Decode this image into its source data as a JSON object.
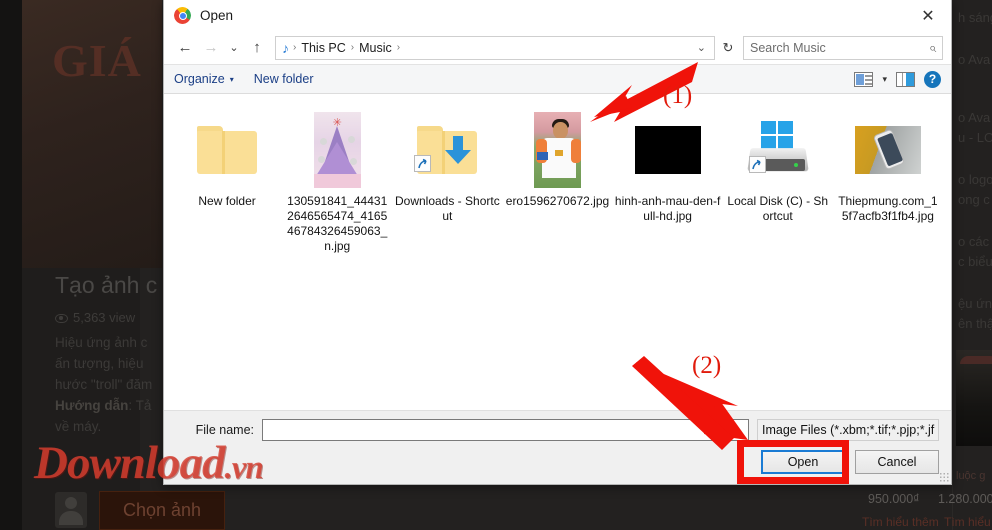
{
  "background": {
    "hero_text": "GIÁ",
    "article_title": "Tạo ảnh c",
    "views": "5,363 view",
    "paragraph_line1": "Hiệu ứng ảnh c",
    "paragraph_line2": "ấn tượng, hiệu",
    "paragraph_line3": "hước \"troll\" đăm",
    "guide_label": "Hướng dẫn",
    "guide_rest": ": Tả",
    "paragraph_line5": "về máy.",
    "choose_image_button": "Chọn ảnh",
    "right_column_lines": [
      "h sáng",
      "o Ava",
      "o Ava",
      "u - LO",
      "o logo",
      "ong c",
      "o các",
      "c biểu",
      "ệu ứng",
      "ên thậ"
    ],
    "price_left": "950.000₫",
    "price_right": "1.280.000",
    "link_left": "Tìm hiểu thêm",
    "link_right": "Tìm hiểu t",
    "product_caption": "luộc g"
  },
  "watermark": {
    "name": "Download",
    "tld": ".vn"
  },
  "dialog": {
    "title": "Open",
    "app_icon": "chrome-icon",
    "close_label": "✕",
    "nav": {
      "back": "←",
      "forward": "→",
      "recent": "⌄",
      "up": "↑",
      "refresh": "↻"
    },
    "breadcrumb": {
      "icon": "♪",
      "items": [
        "This PC",
        "Music"
      ],
      "separator": "›",
      "dropdown": "⌄"
    },
    "search": {
      "placeholder": "Search Music",
      "icon": "⌕"
    },
    "toolbar": {
      "organize": "Organize",
      "organize_caret": "▾",
      "new_folder": "New folder",
      "view_icon": "view-options-icon",
      "view_caret": "▾",
      "pane_icon": "preview-pane-icon",
      "help_icon": "?"
    },
    "files": [
      {
        "name": "New folder",
        "icon": "folder",
        "shortcut": false
      },
      {
        "name": "130591841_444312646565474_416546784326459063_n.jpg",
        "icon": "thumb-xmas",
        "shortcut": false
      },
      {
        "name": "Downloads - Shortcut",
        "icon": "folder-download",
        "shortcut": true
      },
      {
        "name": "ero1596270672.jpg",
        "icon": "thumb-player",
        "shortcut": false
      },
      {
        "name": "hinh-anh-mau-den-full-hd.jpg",
        "icon": "thumb-black",
        "shortcut": false
      },
      {
        "name": "Local Disk (C) - Shortcut",
        "icon": "local-disk",
        "shortcut": true
      },
      {
        "name": "Thiepmung.com_15f7acfb3f1fb4.jpg",
        "icon": "thumb-phone",
        "shortcut": false
      }
    ],
    "footer": {
      "filename_label": "File name:",
      "filename_value": "",
      "filename_placeholder": "",
      "filter_value": "Image Files (*.xbm;*.tif;*.pjp;*.jf",
      "filter_caret": "⌄",
      "open_button": "Open",
      "cancel_button": "Cancel"
    }
  },
  "annotations": [
    {
      "id": "1",
      "label": "(1)",
      "target": "file-item-ero1596270672"
    },
    {
      "id": "2",
      "label": "(2)",
      "target": "open-button"
    }
  ],
  "colors": {
    "annotation_red": "#f0130a",
    "watermark_red": "#d63e30",
    "accent_blue": "#1a7bd4",
    "link_blue": "#1b3f86"
  }
}
